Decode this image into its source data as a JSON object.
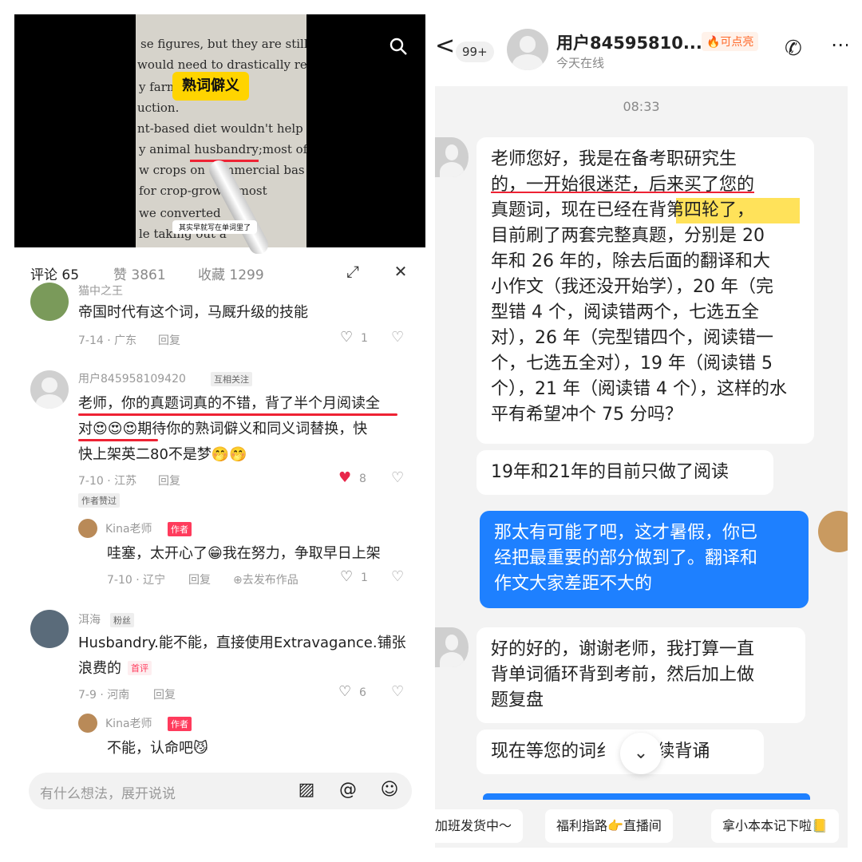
{
  "video": {
    "tag": "熟词僻义",
    "caption": "其实早就写在单词里了",
    "book_lines": [
      "se figures, but they are still g",
      "would need to drastically reduc",
      "y farm",
      "uction.",
      "nt-based diet wouldn't help",
      "y animal husbandry;most of",
      "w crops on commercial bas",
      "for crop-growin most",
      "we converted",
      "le taking out a"
    ]
  },
  "tabs": {
    "comments": "评论 65",
    "likes": "赞 3861",
    "favorites": "收藏 1299"
  },
  "comments": [
    {
      "name": "猫中之王",
      "text": "帝国时代有这个词，马厩升级的技能",
      "date": "7-14 · 广东",
      "reply": "回复",
      "likes": "1"
    },
    {
      "name": "用户845958109420",
      "badge": "互相关注",
      "text1": "老师，你的真题词真的不错，背了半个月阅读全",
      "text2": "对😍😍😍期待你的熟词僻义和同义词替换，快",
      "text3": "快上架英二80不是梦🤭🤭",
      "date": "7-10 · 江苏",
      "reply": "回复",
      "likes": "8",
      "author_liked": "作者赞过"
    },
    {
      "name": "Kina老师",
      "badge": "作者",
      "text": "哇塞，太开心了😁我在努力，争取早日上架",
      "date": "7-10 · 辽宁",
      "reply": "回复",
      "publish": "去发布作品",
      "likes": "1"
    },
    {
      "name": "洱海",
      "badge": "粉丝",
      "text1": "Husbandry.能不能，直接使用Extravagance.铺张",
      "text2": "浪费的",
      "firstbadge": "首评",
      "date": "7-9 · 河南",
      "reply": "回复",
      "likes": "6"
    },
    {
      "name": "Kina老师",
      "badge": "作者",
      "text": "不能，认命吧😼"
    }
  ],
  "comment_bar": {
    "placeholder": "有什么想法，展开说说"
  },
  "chat": {
    "back": "<",
    "unread": "99+",
    "title": "用户84595810...",
    "spark": "🔥可点亮",
    "status": "今天在线",
    "time": "08:33",
    "m1_lines": [
      "老师您好，我是在备考职研究生",
      "的，一开始很迷茫，后来买了您的",
      "真题词，现在已经在背第四轮了，",
      "目前刷了两套完整真题，分别是 20",
      "年和 26 年的，除去后面的翻译和大",
      "小作文（我还没开始学），20 年（完",
      "型错 4 个，阅读错两个，七选五全",
      "对），26 年（完型错四个，阅读错一",
      "个，七选五全对），19 年（阅读错 5",
      "个），21 年（阅读错 4 个），这样的水",
      "平有希望冲个 75 分吗？"
    ],
    "m2": "19年和21年的目前只做了阅读",
    "m3_lines": [
      "那太有可能了吧，这才暑假，你已",
      "经把最重要的部分做到了。翻译和",
      "作文大家差距不大的"
    ],
    "m4_lines": [
      "好的好的，谢谢老师，我打算一直",
      "背单词循环背到考前，然后加上做",
      "题复盘"
    ],
    "m5": "现在等您的词纟 ✕ 继续背诵",
    "chips": [
      "加班发货中～",
      "福利指路👉直播间",
      "拿小本本记下啦📒"
    ]
  }
}
